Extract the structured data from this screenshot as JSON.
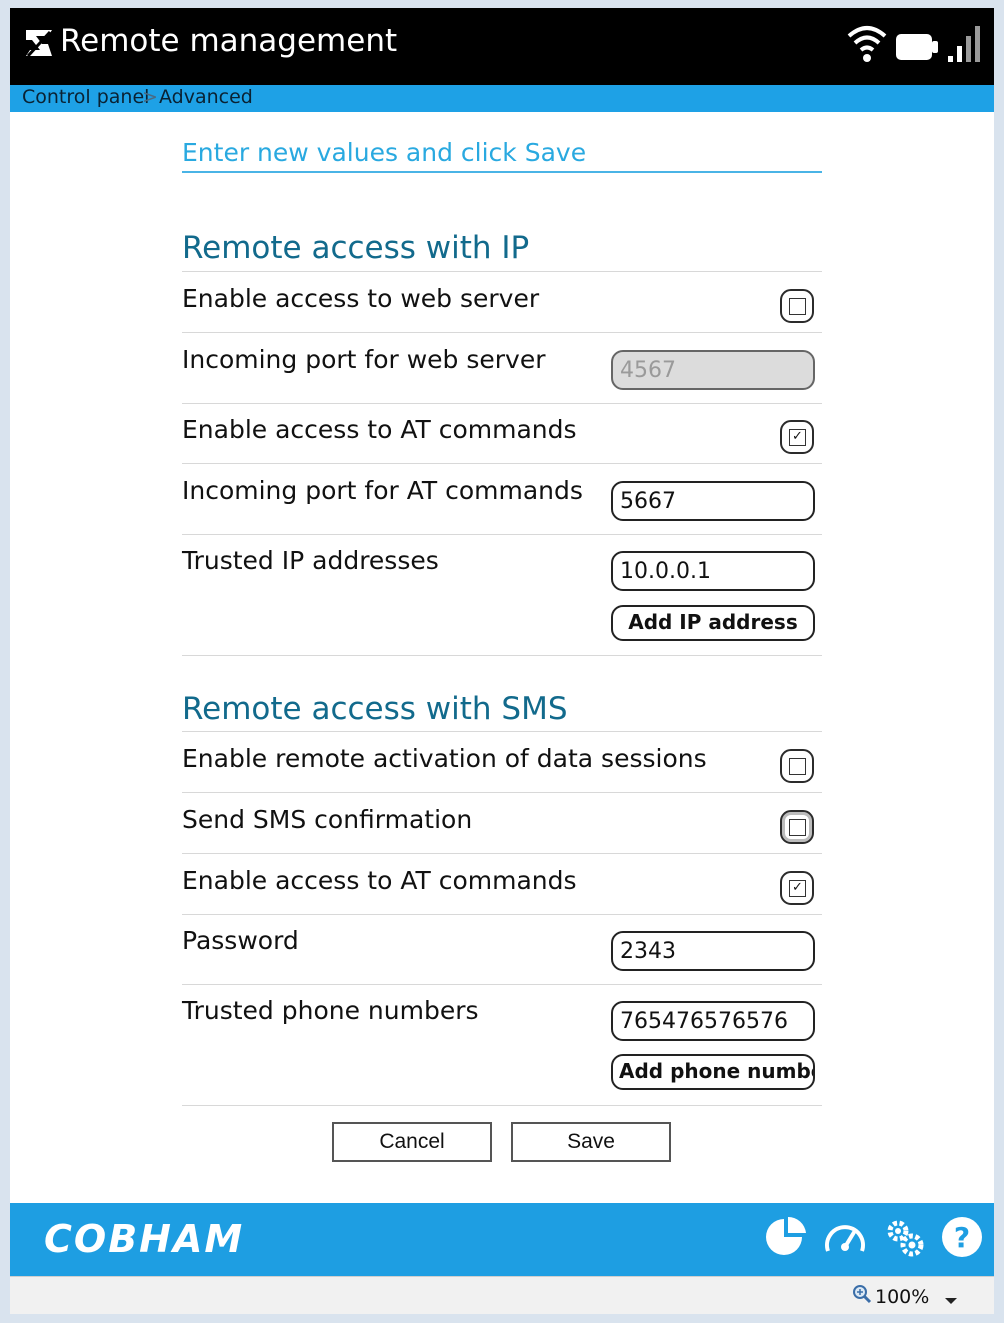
{
  "window": {
    "title": "Remote management"
  },
  "breadcrumb": {
    "items": [
      "Control panel",
      "Advanced"
    ],
    "separator": ">"
  },
  "intro": "Enter new values and click Save",
  "ip_section": {
    "title": "Remote access with IP",
    "enable_web": {
      "label": "Enable access to web server",
      "checked": false
    },
    "web_port": {
      "label": "Incoming port for web server",
      "value": "4567",
      "disabled": true
    },
    "enable_at": {
      "label": "Enable access to AT commands",
      "checked": true
    },
    "at_port": {
      "label": "Incoming port for AT commands",
      "value": "5667"
    },
    "trusted_ip": {
      "label": "Trusted IP addresses",
      "value": "10.0.0.1",
      "add_label": "Add IP address"
    }
  },
  "sms_section": {
    "title": "Remote access with SMS",
    "enable_data": {
      "label": "Enable remote activation of data sessions",
      "checked": false
    },
    "sms_confirm": {
      "label": "Send SMS confirmation",
      "checked": false
    },
    "enable_at": {
      "label": "Enable access to AT commands",
      "checked": true
    },
    "password": {
      "label": "Password",
      "value": "2343"
    },
    "trusted_phone": {
      "label": "Trusted phone numbers",
      "value": "765476576576",
      "add_label": "Add phone number"
    }
  },
  "actions": {
    "cancel": "Cancel",
    "save": "Save"
  },
  "footer": {
    "brand": "COBHAM"
  },
  "statusbar": {
    "zoom": "100%"
  },
  "colors": {
    "accent": "#1ea1e6",
    "section_title": "#126a8c",
    "intro_text": "#29a9e0"
  },
  "icons": [
    "app-icon",
    "wifi-icon",
    "battery-icon",
    "signal-icon",
    "pie-chart-icon",
    "speedometer-icon",
    "settings-icon",
    "help-icon",
    "zoom-icon",
    "dropdown-icon"
  ]
}
